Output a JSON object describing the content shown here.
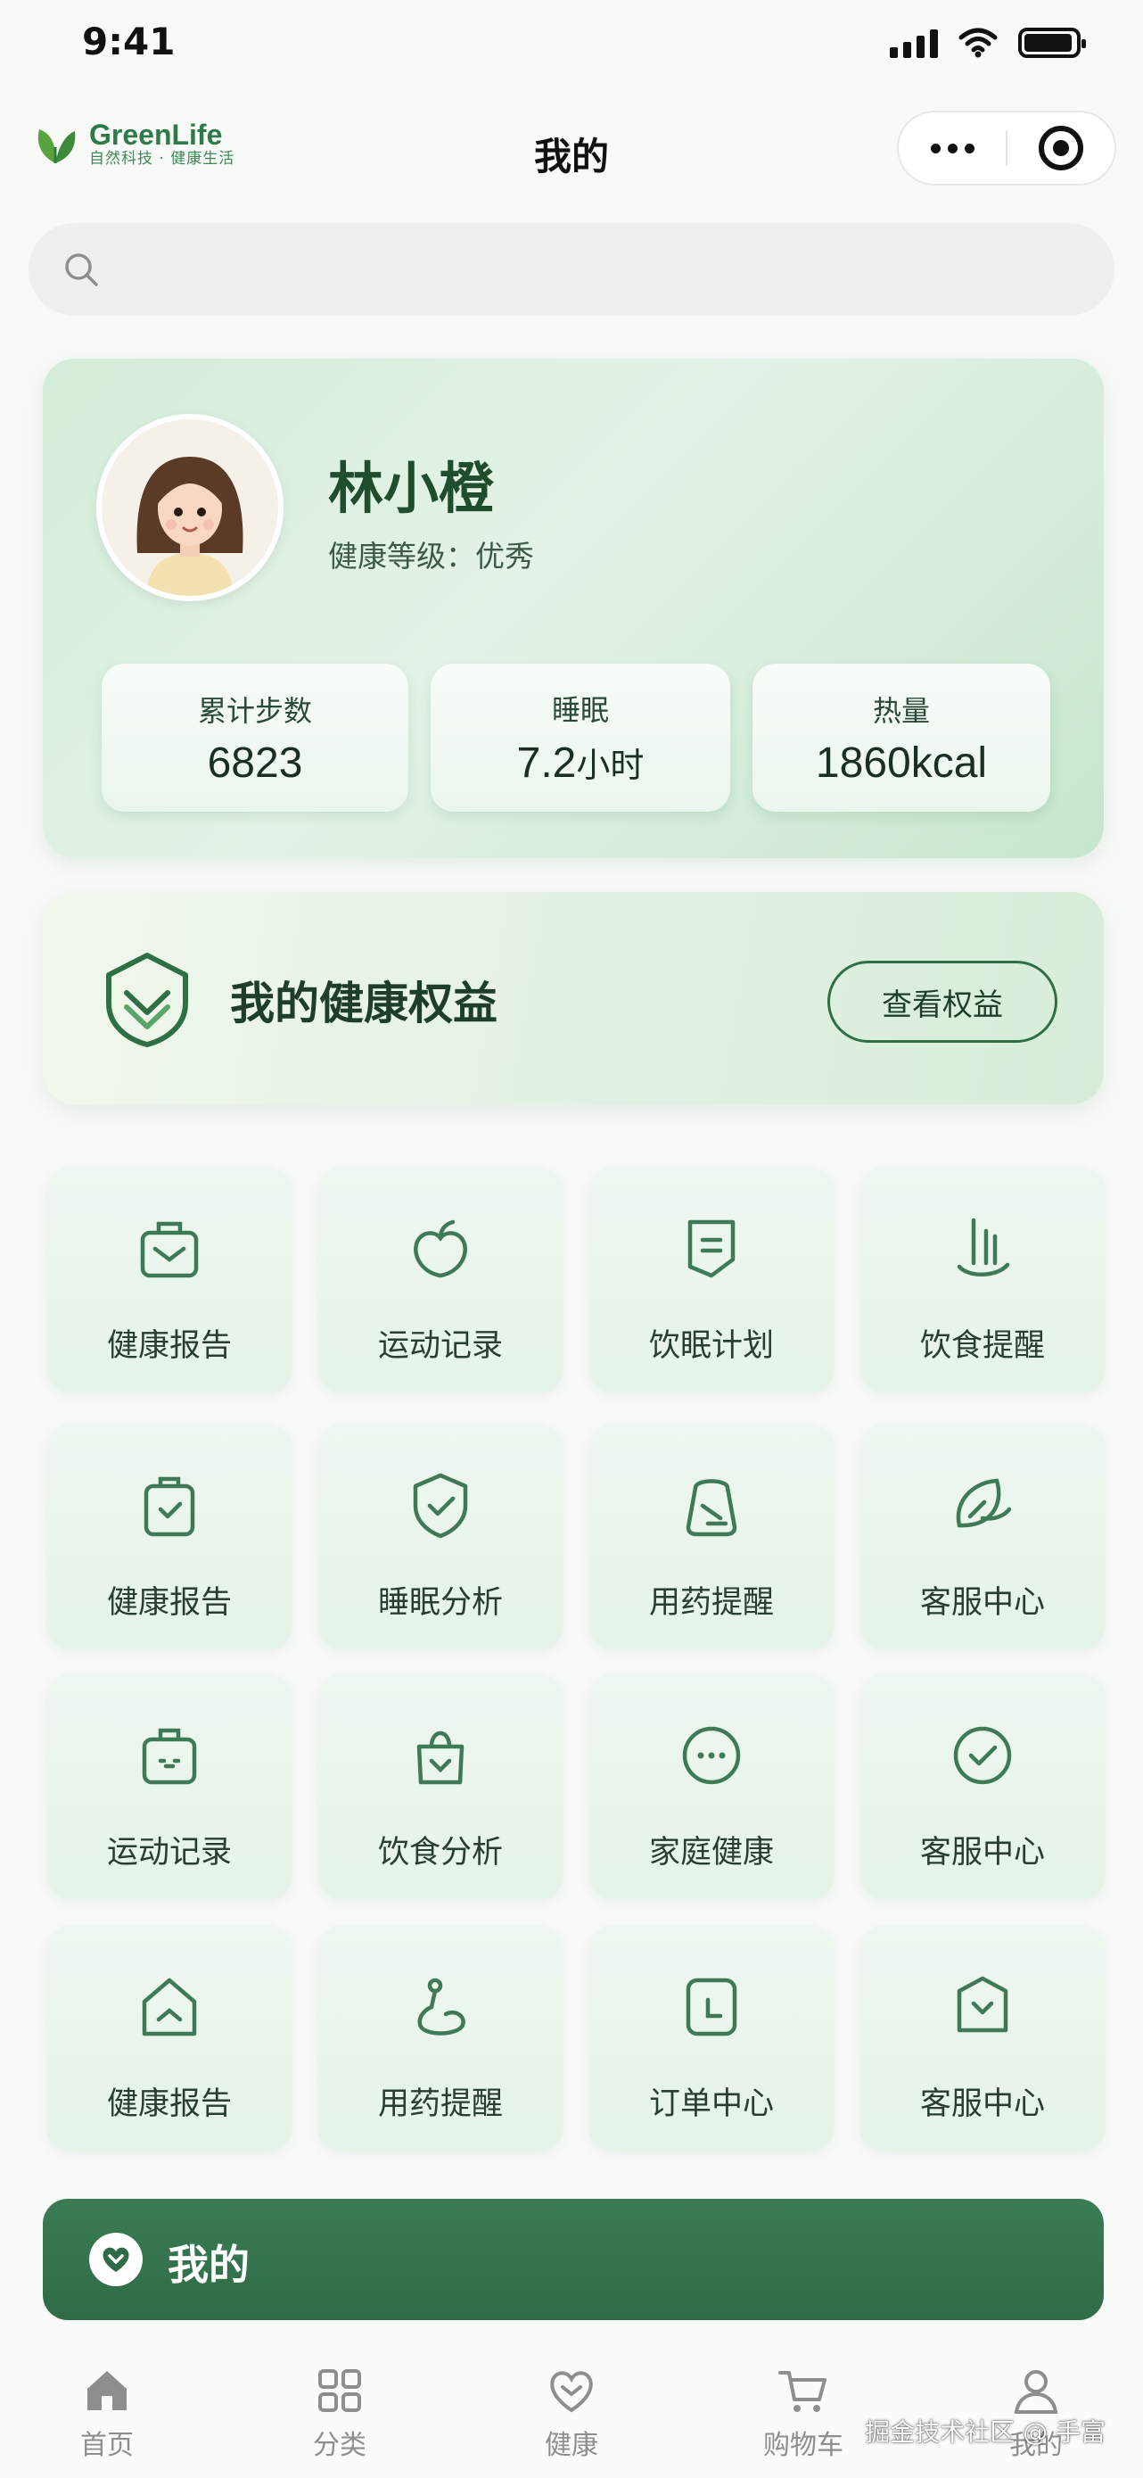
{
  "status_bar": {
    "time": "9:41"
  },
  "nav": {
    "logo_name": "GreenLife",
    "logo_sub": "自然科技 · 健康生活",
    "title": "我的"
  },
  "search": {
    "placeholder": ""
  },
  "profile": {
    "name": "林小橙",
    "level": "健康等级：优秀",
    "stats": [
      {
        "label": "累计步数",
        "value": "6823",
        "unit": ""
      },
      {
        "label": "睡眠",
        "value": "7.2",
        "unit": "小时"
      },
      {
        "label": "热量",
        "value": "1860kcal",
        "unit": ""
      }
    ]
  },
  "rights": {
    "title": "我的健康权益",
    "button": "查看权益"
  },
  "grid": [
    {
      "label": "健康报告",
      "icon": "briefcase-icon"
    },
    {
      "label": "运动记录",
      "icon": "apple-icon"
    },
    {
      "label": "饮眠计划",
      "icon": "note-icon"
    },
    {
      "label": "饮食提醒",
      "icon": "utensils-icon"
    },
    {
      "label": "健康报告",
      "icon": "clipboard-check-icon"
    },
    {
      "label": "睡眠分析",
      "icon": "shield-check-icon"
    },
    {
      "label": "用药提醒",
      "icon": "pill-bottle-icon"
    },
    {
      "label": "客服中心",
      "icon": "leaf-icon"
    },
    {
      "label": "运动记录",
      "icon": "bag-icon"
    },
    {
      "label": "饮食分析",
      "icon": "hand-bag-icon"
    },
    {
      "label": "家庭健康",
      "icon": "chat-bubble-icon"
    },
    {
      "label": "客服中心",
      "icon": "check-circle-icon"
    },
    {
      "label": "健康报告",
      "icon": "home-icon"
    },
    {
      "label": "用药提醒",
      "icon": "health-curve-icon"
    },
    {
      "label": "订单中心",
      "icon": "order-icon"
    },
    {
      "label": "客服中心",
      "icon": "shield-heart-icon"
    }
  ],
  "mine_bar": {
    "label": "我的"
  },
  "tabs": [
    {
      "label": "首页",
      "icon": "home-icon"
    },
    {
      "label": "分类",
      "icon": "grid-icon"
    },
    {
      "label": "健康",
      "icon": "heart-icon"
    },
    {
      "label": "购物车",
      "icon": "cart-icon"
    },
    {
      "label": "我的",
      "icon": "user-icon"
    }
  ],
  "watermark": "掘金技术社区 @ 手富",
  "colors": {
    "brand": "#2f7a4a",
    "accent_dark": "#2f6b46",
    "icon_stroke": "#3f7a58"
  }
}
